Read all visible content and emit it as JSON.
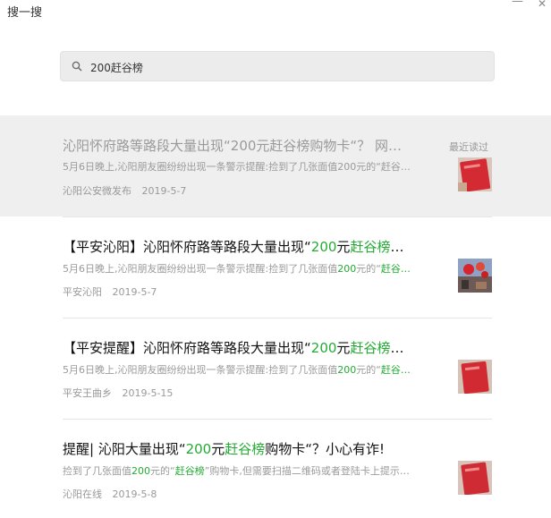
{
  "window": {
    "title": "搜一搜",
    "minimize_glyph": "—",
    "close_glyph": "✕"
  },
  "search": {
    "value": "200赶谷榜",
    "icon": "search-icon"
  },
  "results": [
    {
      "title": "沁阳怀府路等路段大量出现“200元赶谷榜购物卡“？ 网…",
      "snippet": "5月6日晚上,沁阳朋友圈纷纷出现一条警示提醒:捡到了几张面值200元的“赶谷…",
      "source": "沁阳公安微发布",
      "date": "2019-5-7",
      "badge": "最近读过",
      "thumb": "red-card-photo"
    },
    {
      "title_parts": [
        "【平安沁阳】沁阳怀府路等路段大量出现“",
        "200",
        "元",
        "赶谷榜",
        "…"
      ],
      "snippet_parts": [
        "5月6日晚上,沁阳朋友圈纷纷出现一条警示提醒:捡到了几张面值",
        "200",
        "元的“",
        "赶谷…"
      ],
      "source": "平安沁阳",
      "date": "2019-5-7",
      "thumb": "street-photo"
    },
    {
      "title_parts": [
        "【平安提醒】沁阳怀府路等路段大量出现“",
        "200",
        "元",
        "赶谷榜",
        "…"
      ],
      "snippet_parts": [
        "5月6日晚上,沁阳朋友圈纷纷出现一条警示提醒:捡到了几张面值",
        "200",
        "元的“",
        "赶谷…"
      ],
      "source": "平安王曲乡",
      "date": "2019-5-15",
      "thumb": "red-card-photo"
    },
    {
      "title_parts": [
        "提醒| 沁阳大量出现“",
        "200",
        "元",
        "赶谷榜",
        "购物卡“？小心有诈!"
      ],
      "snippet_parts": [
        "捡到了几张面值",
        "200",
        "元的“",
        "赶谷榜",
        "”购物卡,但需要扫描二维码或者登陆卡上提示…"
      ],
      "source": "沁阳在线",
      "date": "2019-5-8",
      "thumb": "red-card-photo"
    }
  ]
}
